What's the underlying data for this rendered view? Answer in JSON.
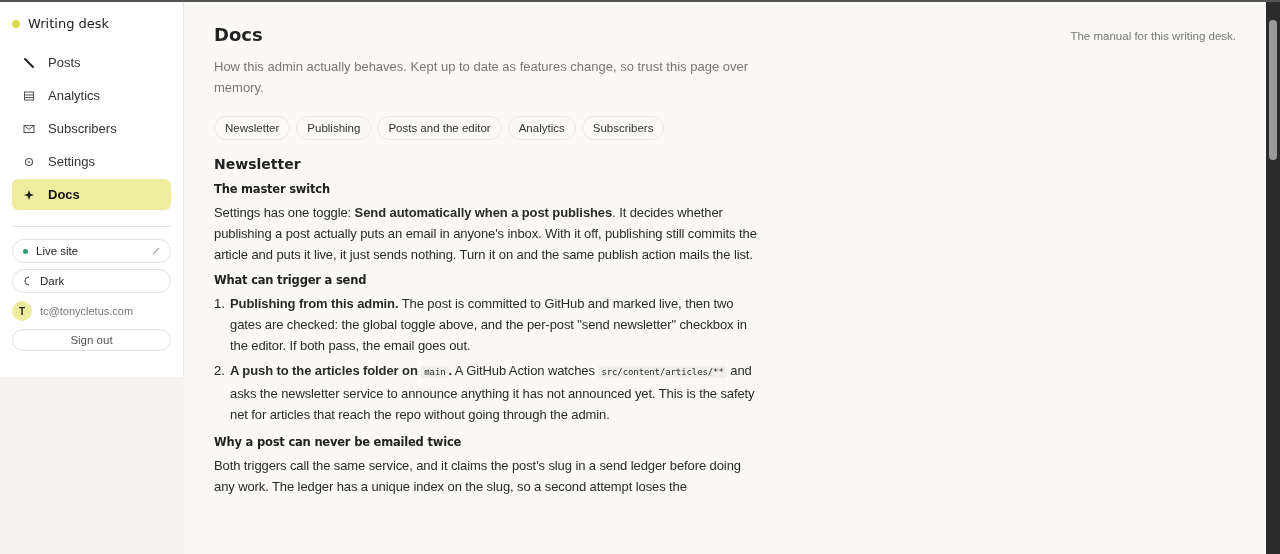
{
  "sidebar": {
    "brand": "Writing desk",
    "nav": [
      {
        "label": "Posts",
        "selected": false
      },
      {
        "label": "Analytics",
        "selected": false
      },
      {
        "label": "Subscribers",
        "selected": false
      },
      {
        "label": "Settings",
        "selected": false
      },
      {
        "label": "Docs",
        "selected": true
      }
    ],
    "live_site": "Live site",
    "theme": "Dark",
    "avatar": "T",
    "email": "tc@tonycletus.com",
    "sign_out": "Sign out"
  },
  "header": {
    "title": "Docs",
    "tagline": "The manual for this writing desk.",
    "intro": "How this admin actually behaves. Kept up to date as features change, so trust this page over memory."
  },
  "chips": [
    {
      "label": "Newsletter"
    },
    {
      "label": "Publishing"
    },
    {
      "label": "Posts and the editor"
    },
    {
      "label": "Analytics"
    },
    {
      "label": "Subscribers"
    }
  ],
  "section": {
    "title": "Newsletter",
    "blocks": [
      {
        "kind": "heading",
        "text": "The master switch"
      },
      {
        "kind": "paragraph",
        "text": "Settings has one toggle: **Send automatically when a post publishes**. It decides whether publishing a post actually puts an email in anyone's inbox. With it off, publishing still commits the article and puts it live, it just sends nothing. Turn it on and the same publish action mails the list."
      },
      {
        "kind": "heading",
        "text": "What can trigger a send"
      },
      {
        "kind": "list",
        "items": [
          {
            "number": "1.",
            "segments": [
              {
                "kind": "bold",
                "text": "Publishing from this admin."
              },
              {
                "kind": "text",
                "text": " The post is committed to GitHub and marked live, then two gates are checked: the global toggle above, and the per-post \"send newsletter\" checkbox in the editor. If both pass, the email goes out."
              }
            ]
          },
          {
            "number": "2.",
            "segments": [
              {
                "kind": "bold",
                "text": "A push to the articles folder on "
              },
              {
                "kind": "code",
                "text": "main"
              },
              {
                "kind": "bold",
                "text": "."
              },
              {
                "kind": "text",
                "text": " A GitHub Action watches "
              },
              {
                "kind": "code",
                "text": "src/content/articles/**"
              },
              {
                "kind": "text",
                "text": " and asks the newsletter service to announce anything it has not announced yet. This is the safety net for articles that reach the repo without going through the admin."
              }
            ]
          }
        ]
      },
      {
        "kind": "heading",
        "text": "Why a post can never be emailed twice"
      },
      {
        "kind": "paragraph",
        "text": "Both triggers call the same service, and it claims the post's slug in a send ledger before doing any work. The ledger has a unique index on the slug, so a second attempt loses the"
      }
    ]
  }
}
